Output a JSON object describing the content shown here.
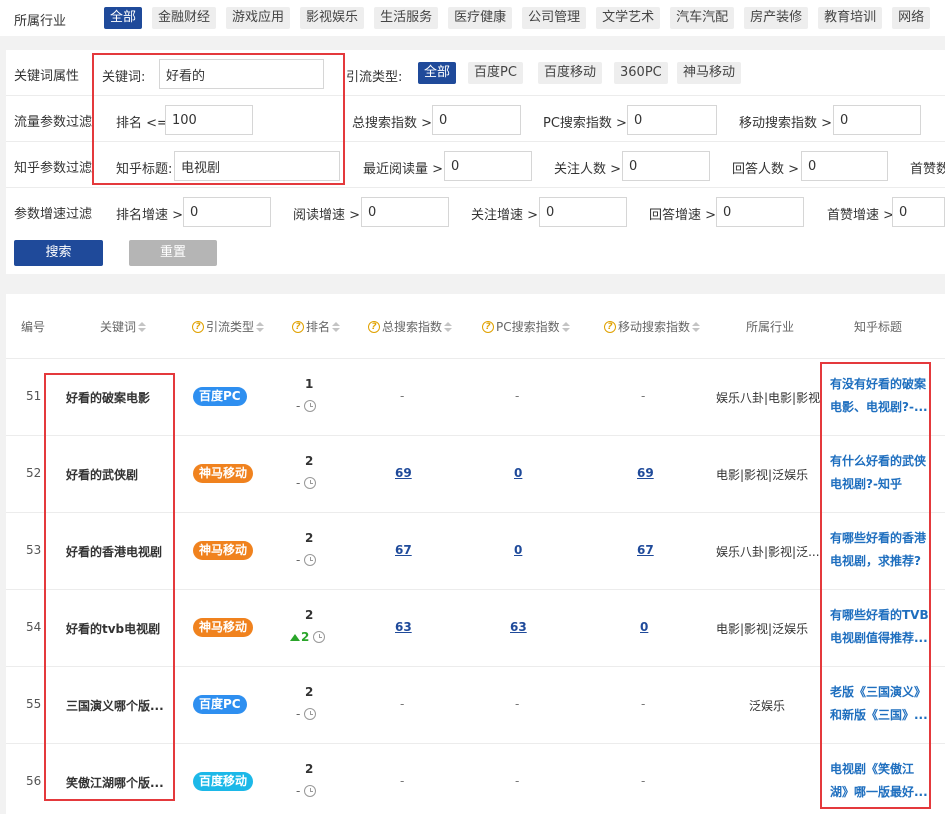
{
  "industry": {
    "label": "所属行业",
    "tags": [
      "全部",
      "金融财经",
      "游戏应用",
      "影视娱乐",
      "生活服务",
      "医疗健康",
      "公司管理",
      "文学艺术",
      "汽车汽配",
      "房产装修",
      "教育培训",
      "网络"
    ]
  },
  "filters": {
    "keyword_row": {
      "label": "关键词属性",
      "keyword_label": "关键词:",
      "keyword_value": "好看的",
      "traffic_type_label": "引流类型:",
      "traffic_types": [
        "全部",
        "百度PC",
        "百度移动",
        "360PC",
        "神马移动"
      ]
    },
    "flow_row": {
      "label": "流量参数过滤",
      "rank_label": "排名 <=",
      "rank_value": "100",
      "total_label": "总搜索指数 >",
      "total_value": "0",
      "pc_label": "PC搜索指数 >",
      "pc_value": "0",
      "mobile_label": "移动搜索指数 >",
      "mobile_value": "0"
    },
    "zhihu_row": {
      "label": "知乎参数过滤",
      "title_label": "知乎标题:",
      "title_value": "电视剧",
      "read_label": "最近阅读量 >",
      "read_value": "0",
      "follow_label": "关注人数 >",
      "follow_value": "0",
      "answer_label": "回答人数 >",
      "answer_value": "0",
      "like_label": "首赞数"
    },
    "growth_row": {
      "label": "参数增速过滤",
      "rank_growth_label": "排名增速 >",
      "rank_growth_value": "0",
      "read_growth_label": "阅读增速 >",
      "read_growth_value": "0",
      "follow_growth_label": "关注增速 >",
      "follow_growth_value": "0",
      "answer_growth_label": "回答增速 >",
      "answer_growth_value": "0",
      "like_growth_label": "首赞增速 >",
      "like_growth_value": "0"
    },
    "search_button": "搜索",
    "reset_button": "重置"
  },
  "table": {
    "headers": {
      "id": "编号",
      "keyword": "关键词",
      "traffic_type": "引流类型",
      "rank": "排名",
      "total": "总搜索指数",
      "pc": "PC搜索指数",
      "mobile": "移动搜索指数",
      "industry": "所属行业",
      "zhihu_title": "知乎标题"
    },
    "rows": [
      {
        "id": "51",
        "keyword": "好看的破案电影",
        "type": "百度PC",
        "type_class": "baidu-pc",
        "rank": "1",
        "rank_change": "-",
        "total": "-",
        "pc": "-",
        "mobile": "-",
        "industry": "娱乐八卦|电影|影视",
        "title_line1": "有没有好看的破案",
        "title_line2": "电影、电视剧?-..."
      },
      {
        "id": "52",
        "keyword": "好看的武侠剧",
        "type": "神马移动",
        "type_class": "shenma",
        "rank": "2",
        "rank_change": "-",
        "total": "69",
        "pc": "0",
        "mobile": "69",
        "industry": "电影|影视|泛娱乐",
        "title_line1": "有什么好看的武侠",
        "title_line2": "电视剧?-知乎"
      },
      {
        "id": "53",
        "keyword": "好看的香港电视剧",
        "type": "神马移动",
        "type_class": "shenma",
        "rank": "2",
        "rank_change": "-",
        "total": "67",
        "pc": "0",
        "mobile": "67",
        "industry": "娱乐八卦|影视|泛...",
        "title_line1": "有哪些好看的香港",
        "title_line2": "电视剧，求推荐?"
      },
      {
        "id": "54",
        "keyword": "好看的tvb电视剧",
        "type": "神马移动",
        "type_class": "shenma",
        "rank": "2",
        "rank_change": "2",
        "rank_up": true,
        "total": "63",
        "pc": "63",
        "mobile": "0",
        "industry": "电影|影视|泛娱乐",
        "title_line1": "有哪些好看的TVB",
        "title_line2": "电视剧值得推荐..."
      },
      {
        "id": "55",
        "keyword": "三国演义哪个版...",
        "type": "百度PC",
        "type_class": "baidu-pc",
        "rank": "2",
        "rank_change": "-",
        "total": "-",
        "pc": "-",
        "mobile": "-",
        "industry": "泛娱乐",
        "title_line1": "老版《三国演义》",
        "title_line2": "和新版《三国》..."
      },
      {
        "id": "56",
        "keyword": "笑傲江湖哪个版...",
        "type": "百度移动",
        "type_class": "baidu-m",
        "rank": "2",
        "rank_change": "-",
        "total": "-",
        "pc": "-",
        "mobile": "-",
        "industry": "",
        "title_line1": "电视剧《笑傲江",
        "title_line2": "湖》哪一版最好..."
      }
    ]
  },
  "colors": {
    "primary": "#1f4a9a",
    "highlight_box": "#e4393c",
    "badge_baidu_pc": "#2e8ff0",
    "badge_shenma": "#f0821e",
    "badge_baidu_mobile": "#1cb8e8",
    "rank_up": "#2aa52a"
  }
}
